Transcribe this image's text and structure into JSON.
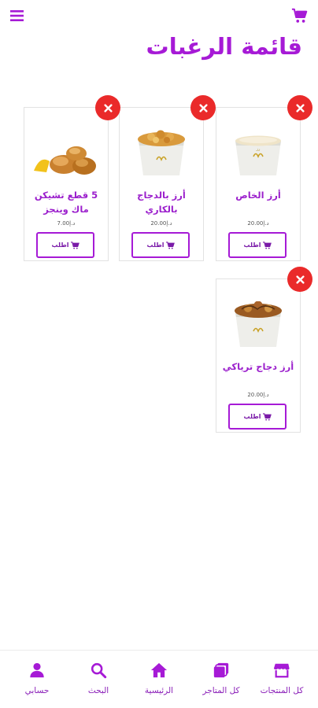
{
  "header": {
    "title": "قائمة الرغبات",
    "menu_icon": "hamburger-menu-icon",
    "cart_icon": "shopping-cart-icon",
    "accent_color": "#a61ad6"
  },
  "wishlist": {
    "items": [
      {
        "name": "أرز الخاص",
        "price": "د.إ20.00",
        "order_label": "اطلب",
        "image": "plain-rice-cup"
      },
      {
        "name": "أرز بالدجاج بالكاري",
        "price": "د.إ20.00",
        "order_label": "اطلب",
        "image": "curry-chicken-rice-cup"
      },
      {
        "name": "5 قطع تشيكن ماك وينجز",
        "price": "د.إ7.00",
        "order_label": "اطلب",
        "image": "chicken-wings"
      },
      {
        "name": "أرز دجاج ترياكي",
        "price": "د.إ20.00",
        "order_label": "اطلب",
        "image": "teriyaki-chicken-rice-cup"
      }
    ],
    "remove_icon": "close-icon",
    "remove_color": "#ea2a2a"
  },
  "bottom_nav": {
    "items": [
      {
        "label": "كل المنتجات",
        "icon": "store-icon"
      },
      {
        "label": "كل المتاجر",
        "icon": "stores-stack-icon"
      },
      {
        "label": "الرئيسية",
        "icon": "home-icon"
      },
      {
        "label": "البحث",
        "icon": "search-icon"
      },
      {
        "label": "حسابي",
        "icon": "user-icon"
      }
    ]
  }
}
